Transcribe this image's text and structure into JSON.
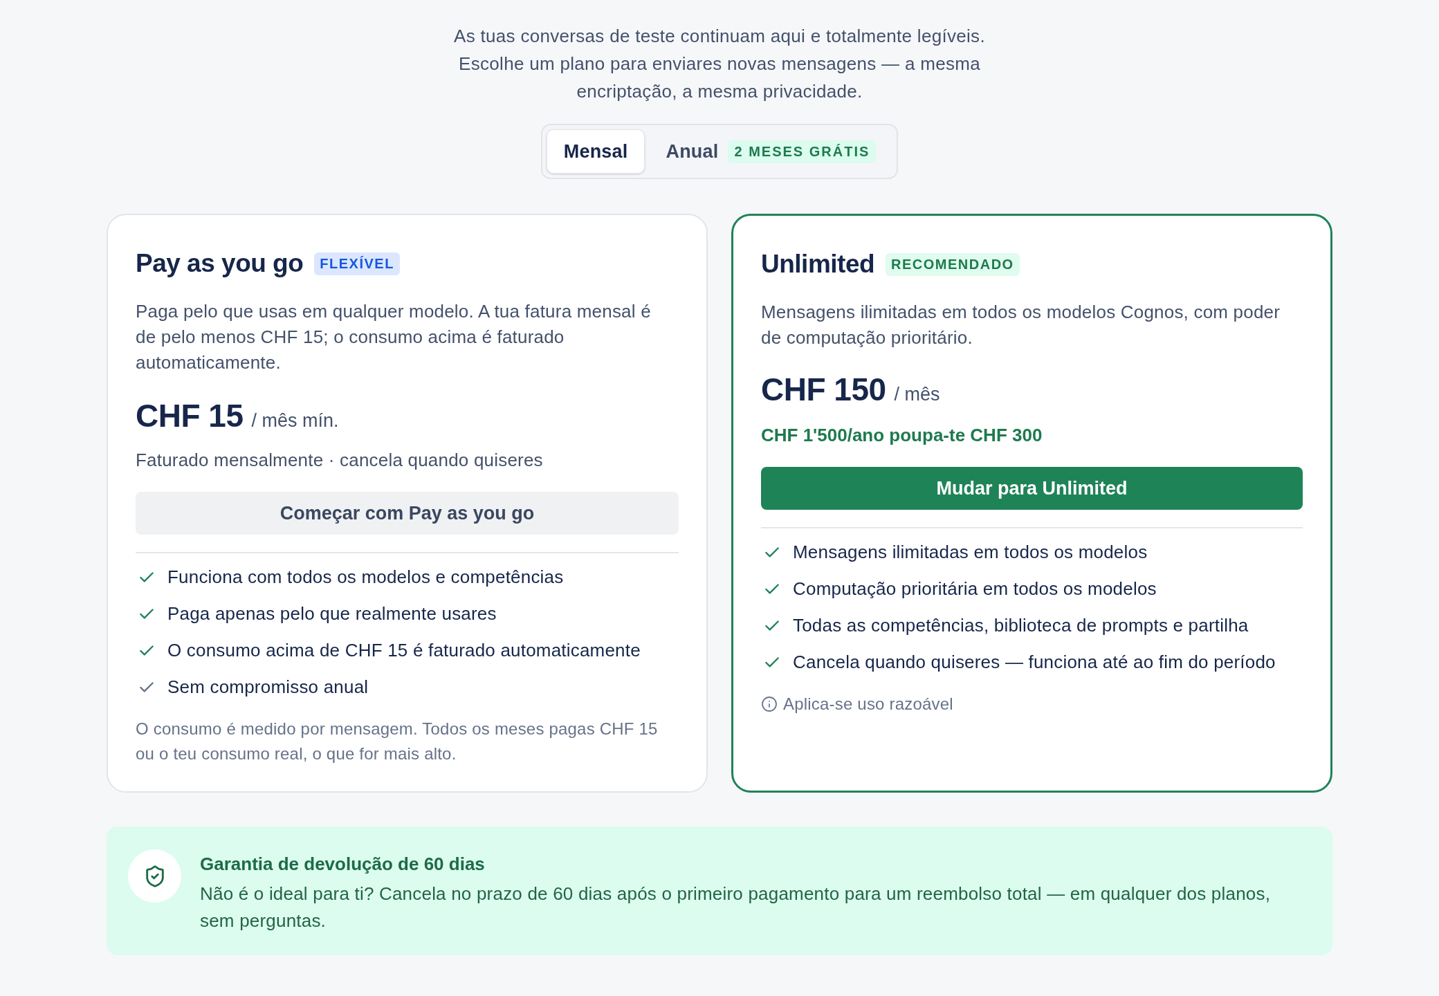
{
  "intro": {
    "text": "As tuas conversas de teste continuam aqui e totalmente legíveis. Escolhe um plano para enviares novas mensagens — a mesma encriptação, a mesma privacidade."
  },
  "billing_toggle": [
    {
      "label": "Mensal",
      "selected": true
    },
    {
      "label": "Anual",
      "selected": false,
      "badge": "2 MESES GRÁTIS"
    }
  ],
  "plans": [
    {
      "name": "Pay as you go",
      "badge": {
        "text": "FLEXÍVEL",
        "color": "#1a56db"
      },
      "recommended": false,
      "description": "Paga pelo que usas em qualquer modelo. A tua fatura mensal é de pelo menos CHF 15; o consumo acima é faturado automaticamente.",
      "price": "CHF 15",
      "period": "/ mês mín.",
      "billing_note": "Faturado mensalmente · cancela quando quiseres",
      "button": "Começar com Pay as you go",
      "features": [
        {
          "text": "Funciona com todos os modelos e competências",
          "muted": false
        },
        {
          "text": "Paga apenas pelo que realmente usares",
          "muted": false
        },
        {
          "text": "O consumo acima de CHF 15 é faturado automaticamente",
          "muted": false
        },
        {
          "text": "Sem compromisso anual",
          "muted": true
        }
      ],
      "footnote": "O consumo é medido por mensagem. Todos os meses pagas CHF 15 ou o teu consumo real, o que for mais alto."
    },
    {
      "name": "Unlimited",
      "badge": {
        "text": "RECOMENDADO",
        "color": "#1e7a4e"
      },
      "recommended": true,
      "description": "Mensagens ilimitadas em todos os modelos Cognos, com poder de computação prioritário.",
      "price": "CHF 150",
      "period": "/ mês",
      "savings": "CHF 1'500/ano poupa-te CHF 300",
      "button": "Mudar para Unlimited",
      "features": [
        {
          "text": "Mensagens ilimitadas em todos os modelos",
          "muted": false
        },
        {
          "text": "Computação prioritária em todos os modelos",
          "muted": false
        },
        {
          "text": "Todas as competências, biblioteca de prompts e partilha",
          "muted": false
        },
        {
          "text": "Cancela quando quiseres — funciona até ao fim do período",
          "muted": false
        }
      ],
      "info": "Aplica-se uso razoável"
    }
  ],
  "guarantee": {
    "title": "Garantia de devolução de 60 dias",
    "text": "Não é o ideal para ti? Cancela no prazo de 60 dias após o primeiro pagamento para um reembolso total — em qualquer dos planos, sem perguntas."
  }
}
